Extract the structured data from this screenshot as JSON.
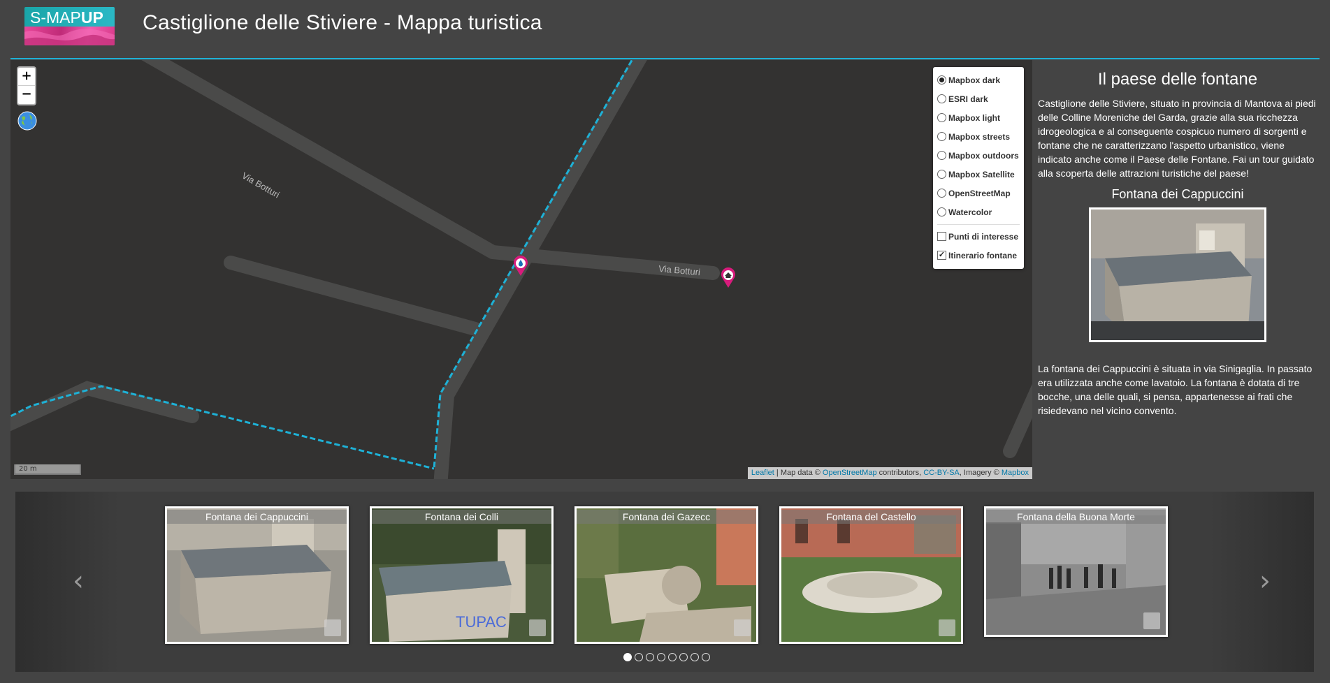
{
  "header": {
    "logo_prefix": "S-MAP",
    "logo_suffix": "UP",
    "title": "Castiglione delle Stiviere - Mappa turistica"
  },
  "map": {
    "zoom_in": "+",
    "zoom_out": "−",
    "street_label_1": "Via Botturi",
    "street_label_2": "Via Botturi",
    "scale": "20 m",
    "attribution": {
      "leaflet": "Leaflet",
      "mapdata": " | Map data © ",
      "osm": "OpenStreetMap",
      "contrib": " contributors, ",
      "license": "CC-BY-SA",
      "imagery": ", Imagery © ",
      "mapbox": "Mapbox"
    },
    "layers": {
      "base": [
        {
          "label": "Mapbox dark",
          "selected": true
        },
        {
          "label": "ESRI dark",
          "selected": false
        },
        {
          "label": "Mapbox light",
          "selected": false
        },
        {
          "label": "Mapbox streets",
          "selected": false
        },
        {
          "label": "Mapbox outdoors",
          "selected": false
        },
        {
          "label": "Mapbox Satellite",
          "selected": false
        },
        {
          "label": "OpenStreetMap",
          "selected": false
        },
        {
          "label": "Watercolor",
          "selected": false
        }
      ],
      "overlays": [
        {
          "label": "Punti di interesse",
          "checked": false
        },
        {
          "label": "Itinerario fontane",
          "checked": true
        }
      ]
    },
    "colors": {
      "route": "#1eb1d6",
      "road": "#4a4a49",
      "marker": "#d81b7c"
    }
  },
  "sidebar": {
    "title": "Il paese delle fontane",
    "intro": "Castiglione delle Stiviere, situato in provincia di Mantova ai piedi delle Colline Moreniche del Garda, grazie alla sua ricchezza idrogeologica e al conseguente cospicuo numero di sorgenti e fontane che ne caratterizzano l'aspetto urbanistico, viene indicato anche come il Paese delle Fontane. Fai un tour guidato alla scoperta delle attrazioni turistiche del paese!",
    "fountain_title": "Fontana dei Cappuccini",
    "fountain_desc": "La fontana dei Cappuccini è situata in via Sinigaglia. In passato era utilizzata anche come lavatoio. La fontana è dotata di tre bocche, una delle quali, si pensa, appartenesse ai frati che risiedevano nel vicino convento."
  },
  "carousel": {
    "prev": "‹",
    "next": "›",
    "cards": [
      {
        "label": "Fontana dei Cappuccini"
      },
      {
        "label": "Fontana dei Colli"
      },
      {
        "label": "Fontana dei Gazecc"
      },
      {
        "label": "Fontana del Castello"
      },
      {
        "label": "Fontana della Buona Morte"
      }
    ],
    "active_page": 1,
    "page_count": 8
  }
}
